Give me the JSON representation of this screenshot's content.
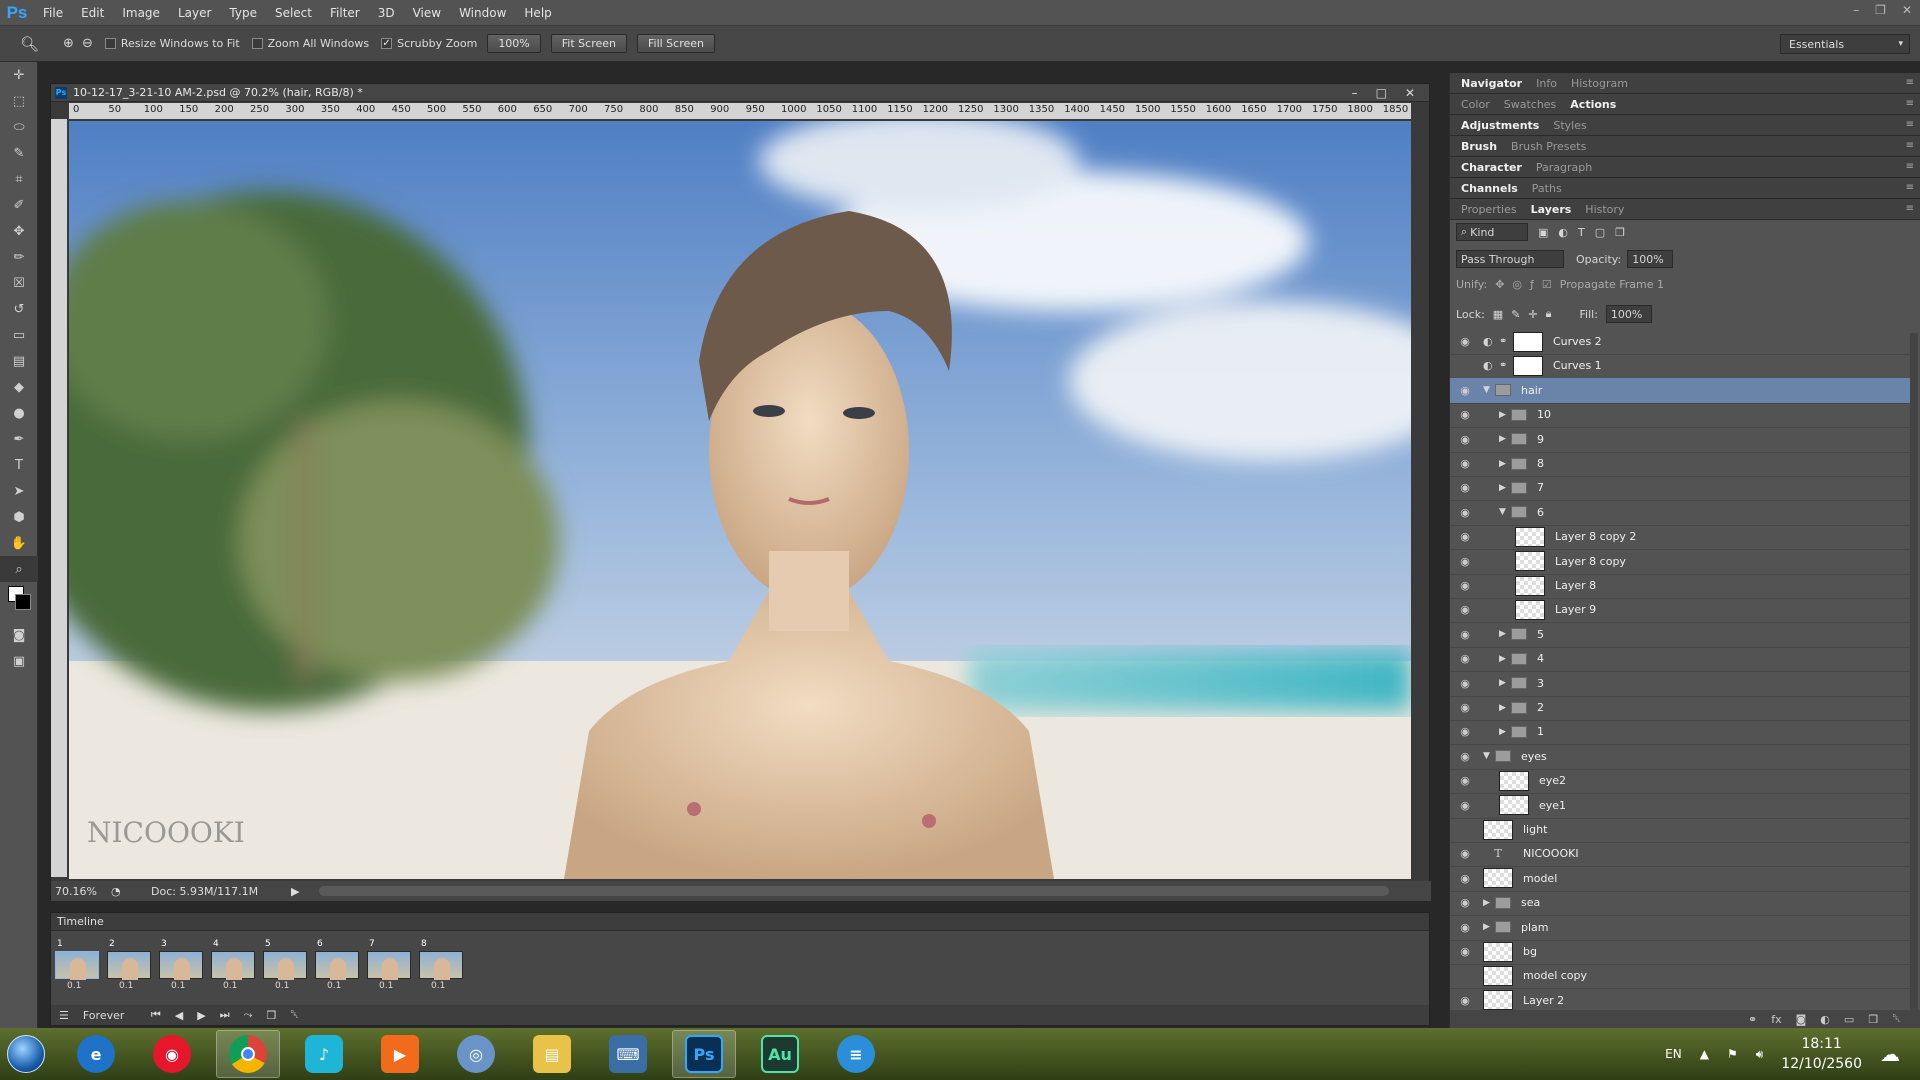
{
  "app": {
    "logo": "Ps"
  },
  "menu": [
    "File",
    "Edit",
    "Image",
    "Layer",
    "Type",
    "Select",
    "Filter",
    "3D",
    "View",
    "Window",
    "Help"
  ],
  "options": {
    "resize_windows": "Resize Windows to Fit",
    "zoom_all": "Zoom All Windows",
    "scrubby_zoom": "Scrubby Zoom",
    "zoom_value": "100%",
    "fit_screen": "Fit Screen",
    "fill_screen": "Fill Screen",
    "workspace": "Essentials"
  },
  "document": {
    "title": "10-12-17_3-21-10 AM-2.psd @ 70.2% (hair, RGB/8) *",
    "zoom": "70.16%",
    "doc_size": "Doc: 5.93M/117.1M",
    "watermark": "NICOOOKI",
    "ruler_ticks": [
      "0",
      "50",
      "100",
      "150",
      "200",
      "250",
      "300",
      "350",
      "400",
      "450",
      "500",
      "550",
      "600",
      "650",
      "700",
      "750",
      "800",
      "850",
      "900",
      "950",
      "1000",
      "1050",
      "1100",
      "1150",
      "1200",
      "1250",
      "1300",
      "1350",
      "1400",
      "1450",
      "1500",
      "1550",
      "1600",
      "1650",
      "1700",
      "1750",
      "1800",
      "1850"
    ]
  },
  "timeline": {
    "label": "Timeline",
    "frames": [
      {
        "n": "1",
        "delay": "0.1"
      },
      {
        "n": "2",
        "delay": "0.1"
      },
      {
        "n": "3",
        "delay": "0.1"
      },
      {
        "n": "4",
        "delay": "0.1"
      },
      {
        "n": "5",
        "delay": "0.1"
      },
      {
        "n": "6",
        "delay": "0.1"
      },
      {
        "n": "7",
        "delay": "0.1"
      },
      {
        "n": "8",
        "delay": "0.1"
      }
    ],
    "loop": "Forever"
  },
  "panels": {
    "row1": [
      "Navigator",
      "Info",
      "Histogram"
    ],
    "row2": [
      "Color",
      "Swatches",
      "Actions"
    ],
    "row3": [
      "Adjustments",
      "Styles"
    ],
    "row4": [
      "Brush",
      "Brush Presets"
    ],
    "row5": [
      "Character",
      "Paragraph"
    ],
    "row6": [
      "Channels",
      "Paths"
    ],
    "row7": [
      "Properties",
      "Layers",
      "History"
    ]
  },
  "layers_panel": {
    "kind": "Kind",
    "blend": "Pass Through",
    "opacity_label": "Opacity:",
    "opacity": "100%",
    "unify": "Unify:",
    "propagate": "Propagate Frame 1",
    "lock": "Lock:",
    "fill_label": "Fill:",
    "fill": "100%"
  },
  "layers": [
    {
      "name": "Curves 2",
      "type": "adj",
      "indent": 0,
      "visible": true
    },
    {
      "name": "Curves 1",
      "type": "adj",
      "indent": 0,
      "visible": false
    },
    {
      "name": "hair",
      "type": "folder-open",
      "indent": 0,
      "visible": true,
      "selected": true
    },
    {
      "name": "10",
      "type": "folder",
      "indent": 1,
      "visible": true
    },
    {
      "name": "9",
      "type": "folder",
      "indent": 1,
      "visible": true
    },
    {
      "name": "8",
      "type": "folder",
      "indent": 1,
      "visible": true
    },
    {
      "name": "7",
      "type": "folder",
      "indent": 1,
      "visible": true
    },
    {
      "name": "6",
      "type": "folder-open",
      "indent": 1,
      "visible": true
    },
    {
      "name": "Layer 8 copy 2",
      "type": "pixel",
      "indent": 2,
      "visible": true
    },
    {
      "name": "Layer 8 copy",
      "type": "pixel",
      "indent": 2,
      "visible": true
    },
    {
      "name": "Layer 8",
      "type": "pixel",
      "indent": 2,
      "visible": true
    },
    {
      "name": "Layer 9",
      "type": "pixel",
      "indent": 2,
      "visible": true
    },
    {
      "name": "5",
      "type": "folder",
      "indent": 1,
      "visible": true
    },
    {
      "name": "4",
      "type": "folder",
      "indent": 1,
      "visible": true
    },
    {
      "name": "3",
      "type": "folder",
      "indent": 1,
      "visible": true
    },
    {
      "name": "2",
      "type": "folder",
      "indent": 1,
      "visible": true
    },
    {
      "name": "1",
      "type": "folder",
      "indent": 1,
      "visible": true
    },
    {
      "name": "eyes",
      "type": "folder-open",
      "indent": 0,
      "visible": true
    },
    {
      "name": "eye2",
      "type": "pixel",
      "indent": 1,
      "visible": true
    },
    {
      "name": "eye1",
      "type": "pixel",
      "indent": 1,
      "visible": true
    },
    {
      "name": "light",
      "type": "pixel",
      "indent": 0,
      "visible": false
    },
    {
      "name": "NICOOOKI",
      "type": "text",
      "indent": 0,
      "visible": true
    },
    {
      "name": "model",
      "type": "pixel",
      "indent": 0,
      "visible": true
    },
    {
      "name": "sea",
      "type": "folder",
      "indent": 0,
      "visible": true
    },
    {
      "name": "plam",
      "type": "folder",
      "indent": 0,
      "visible": true
    },
    {
      "name": "bg",
      "type": "pixel",
      "indent": 0,
      "visible": true
    },
    {
      "name": "model copy",
      "type": "pixel",
      "indent": 0,
      "visible": false
    },
    {
      "name": "Layer 2",
      "type": "pixel",
      "indent": 0,
      "visible": true
    }
  ],
  "taskbar": {
    "apps": [
      "ie-icon",
      "weibo-icon",
      "chrome-icon",
      "music-icon",
      "media-icon",
      "browser-icon",
      "explorer-icon",
      "keyboard-icon",
      "Ps",
      "Au",
      "stack-icon"
    ],
    "lang": "EN",
    "time": "18:11",
    "date": "12/10/2560"
  },
  "colors": {
    "accent": "#31a8ff",
    "selection": "#6a83a8"
  }
}
